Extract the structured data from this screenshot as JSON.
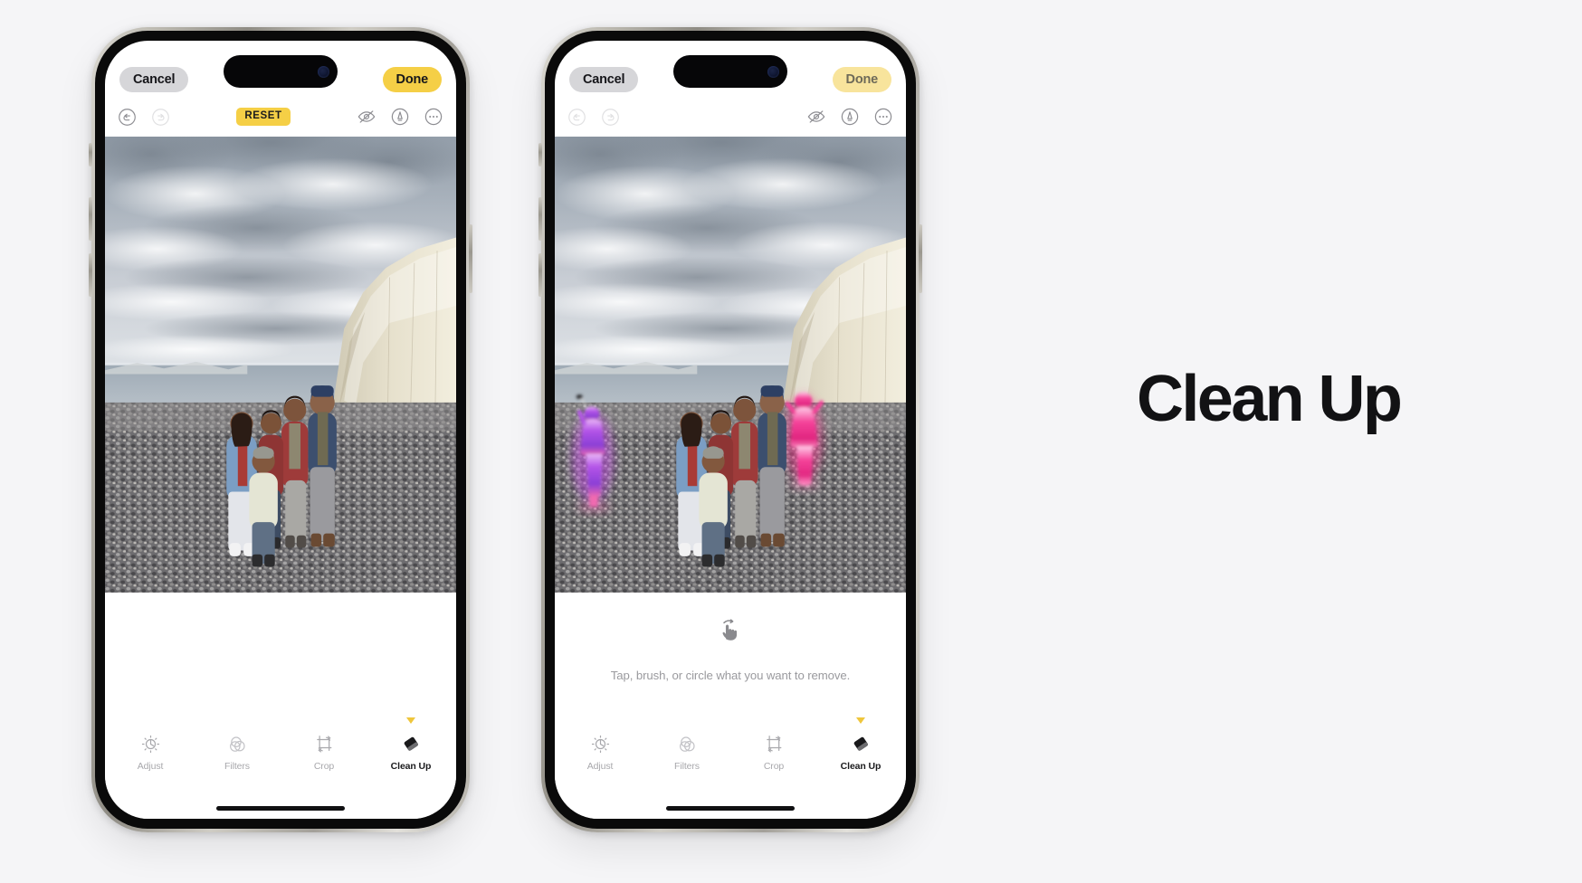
{
  "page": {
    "background_color": "#f5f5f7",
    "headline": "Clean Up"
  },
  "colors": {
    "accent_yellow": "#f5cf46",
    "accent_yellow_dim": "#f8e49c",
    "cancel_gray": "#d6d6d9",
    "label_inactive": "#a8a8ac",
    "label_active": "#1a1a1c",
    "hint_gray": "#9a9a9e"
  },
  "phones": [
    {
      "id": "phone-before",
      "topbar": {
        "cancel_label": "Cancel",
        "done_label": "Done",
        "done_state": "enabled"
      },
      "toolrow": {
        "undo_icon": "undo-arrow-icon",
        "undo_state": "enabled",
        "redo_icon": "redo-arrow-icon",
        "redo_state": "disabled",
        "reset_label": "RESET",
        "reset_visible": true,
        "markup_icon": "markup-pen-icon",
        "hide_icon": "eye-slash-icon",
        "more_icon": "more-ellipsis-icon",
        "right_icons_visible": true
      },
      "photo": {
        "alt": "family-portrait-on-pebble-beach-with-chalk-cliff",
        "cleaned": true,
        "highlights": []
      },
      "lower": {
        "gesture_icon_visible": false,
        "gesture_icon": "",
        "hint_text": ""
      },
      "tabs": [
        {
          "label": "Adjust",
          "icon": "adjust-dial-icon",
          "active": false
        },
        {
          "label": "Filters",
          "icon": "filters-circles-icon",
          "active": false
        },
        {
          "label": "Crop",
          "icon": "crop-frame-icon",
          "active": false
        },
        {
          "label": "Clean Up",
          "icon": "cleanup-eraser-icon",
          "active": true
        }
      ]
    },
    {
      "id": "phone-after",
      "topbar": {
        "cancel_label": "Cancel",
        "done_label": "Done",
        "done_state": "dimmed"
      },
      "toolrow": {
        "undo_icon": "undo-arrow-icon",
        "undo_state": "disabled",
        "redo_icon": "redo-arrow-icon",
        "redo_state": "disabled",
        "reset_label": "RESET",
        "reset_visible": false,
        "markup_icon": "markup-pen-icon",
        "hide_icon": "eye-slash-icon",
        "more_icon": "more-ellipsis-icon",
        "right_icons_visible": true
      },
      "photo": {
        "alt": "family-portrait-on-pebble-beach-with-two-glowing-removable-subjects",
        "cleaned": false,
        "highlights": [
          {
            "name": "left-bystander-with-selfie-stick",
            "color": "#c04fe0"
          },
          {
            "name": "right-bystander-in-pink",
            "color": "#ef3b8e"
          }
        ]
      },
      "lower": {
        "gesture_icon_visible": true,
        "gesture_icon": "tap-brush-hand-icon",
        "hint_text": "Tap, brush, or circle what you want to remove."
      },
      "tabs": [
        {
          "label": "Adjust",
          "icon": "adjust-dial-icon",
          "active": false
        },
        {
          "label": "Filters",
          "icon": "filters-circles-icon",
          "active": false
        },
        {
          "label": "Crop",
          "icon": "crop-frame-icon",
          "active": false
        },
        {
          "label": "Clean Up",
          "icon": "cleanup-eraser-icon",
          "active": true
        }
      ]
    }
  ]
}
